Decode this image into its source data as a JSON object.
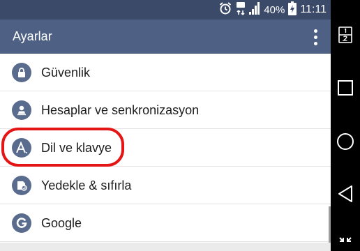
{
  "status_bar": {
    "battery_percent": "40%",
    "time": "11:11",
    "icons": [
      "alarm-icon",
      "data-signal-icon",
      "signal-bars-icon",
      "battery-charging-icon"
    ]
  },
  "app_bar": {
    "title": "Ayarlar",
    "menu_icon": "overflow-menu-icon"
  },
  "settings_items": [
    {
      "label": "Güvenlik",
      "icon": "lock-icon"
    },
    {
      "label": "Hesaplar ve senkronizasyon",
      "icon": "account-icon"
    },
    {
      "label": "Dil ve klavye",
      "icon": "language-icon",
      "highlighted": true
    },
    {
      "label": "Yedekle & sıfırla",
      "icon": "backup-icon"
    },
    {
      "label": "Google",
      "icon": "google-icon"
    }
  ],
  "nav_bar": {
    "buttons": [
      "dual-window-icon",
      "recents-icon",
      "home-icon",
      "back-icon",
      "notification-expand-icon"
    ]
  },
  "colors": {
    "status_bar": "#3b4a68",
    "app_bar": "#4e6184",
    "icon_circle": "#5a6c8d",
    "highlight_ring": "#e41515",
    "nav_bar": "#000000"
  }
}
